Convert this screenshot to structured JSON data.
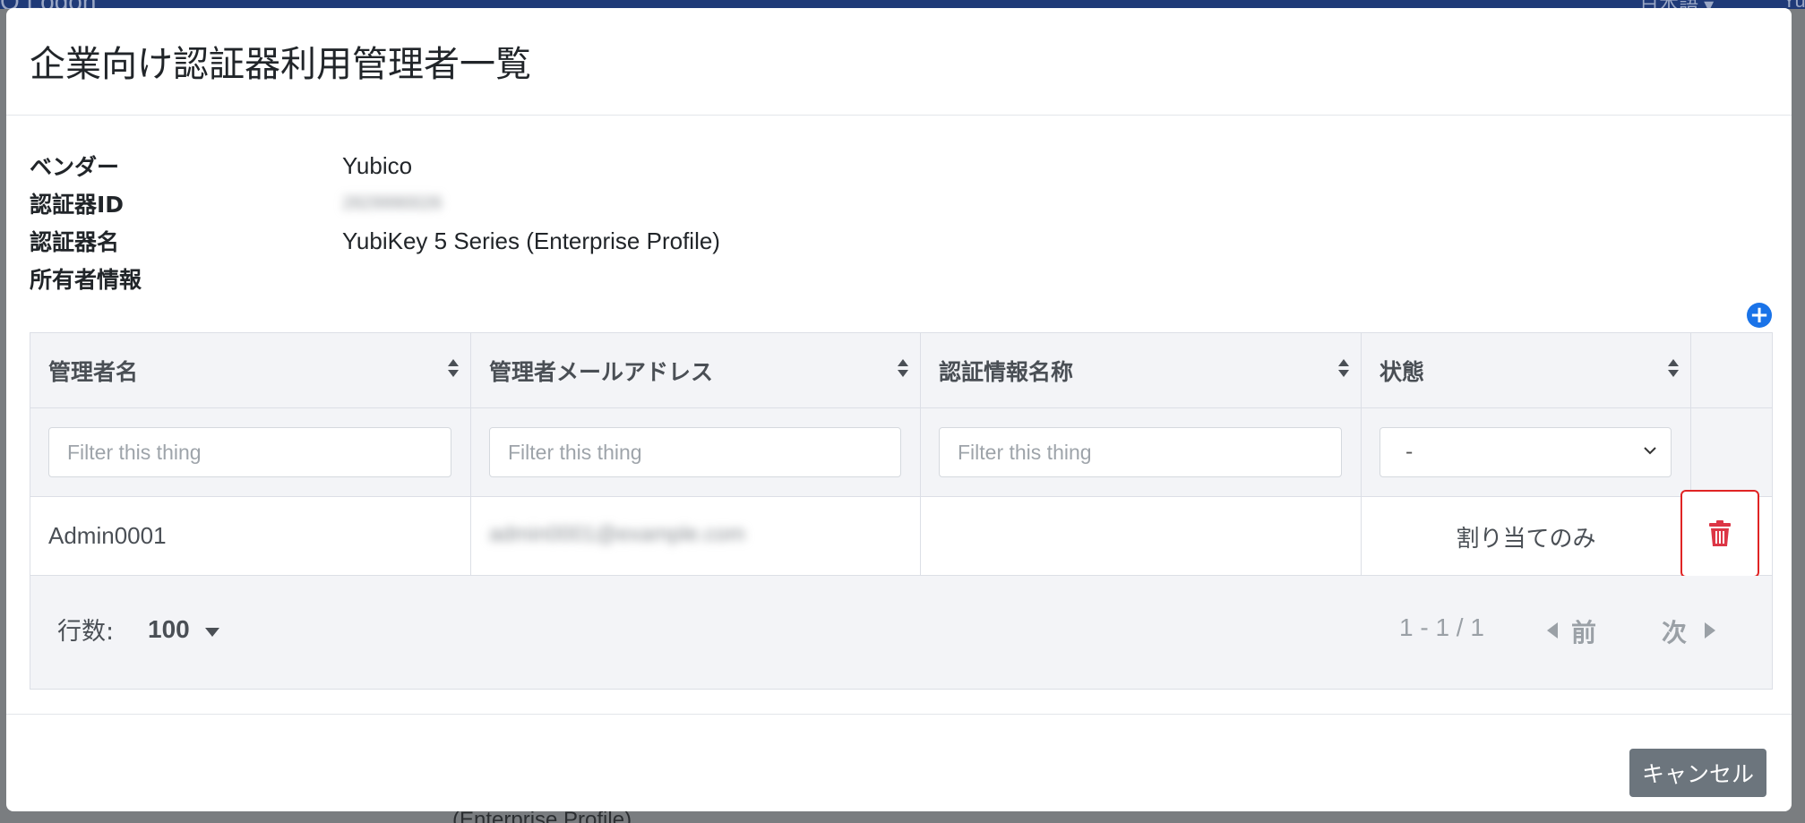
{
  "background": {
    "brand": "O Logon",
    "language": "日本語 ▾",
    "user": "Yu",
    "snippet_bottom": "(Enterprise Profile)"
  },
  "modal": {
    "title": "企業向け認証器利用管理者一覧",
    "info": [
      {
        "label": "ベンダー",
        "value": "Yubico"
      },
      {
        "label": "認証器ID",
        "value": "2829990026"
      },
      {
        "label": "認証器名",
        "value": "YubiKey 5 Series (Enterprise Profile)"
      },
      {
        "label": "所有者情報",
        "value": ""
      }
    ],
    "add_icon": "plus-circle-icon",
    "table": {
      "columns": [
        "管理者名",
        "管理者メールアドレス",
        "認証情報名称",
        "状態"
      ],
      "filter_placeholder": "Filter this thing",
      "status_filter_value": "-",
      "rows": [
        {
          "name": "Admin0001",
          "email": "admin0001@example.com",
          "credential_name": "",
          "status": "割り当てのみ"
        }
      ]
    },
    "footer_pager": {
      "rows_label": "行数:",
      "rows_value": "100",
      "range": "1 - 1 / 1",
      "prev": "前",
      "next": "次"
    },
    "cancel_label": "キャンセル"
  },
  "colors": {
    "accent": "#1a73e8",
    "danger": "#e02424",
    "secondary": "#6c757d"
  }
}
